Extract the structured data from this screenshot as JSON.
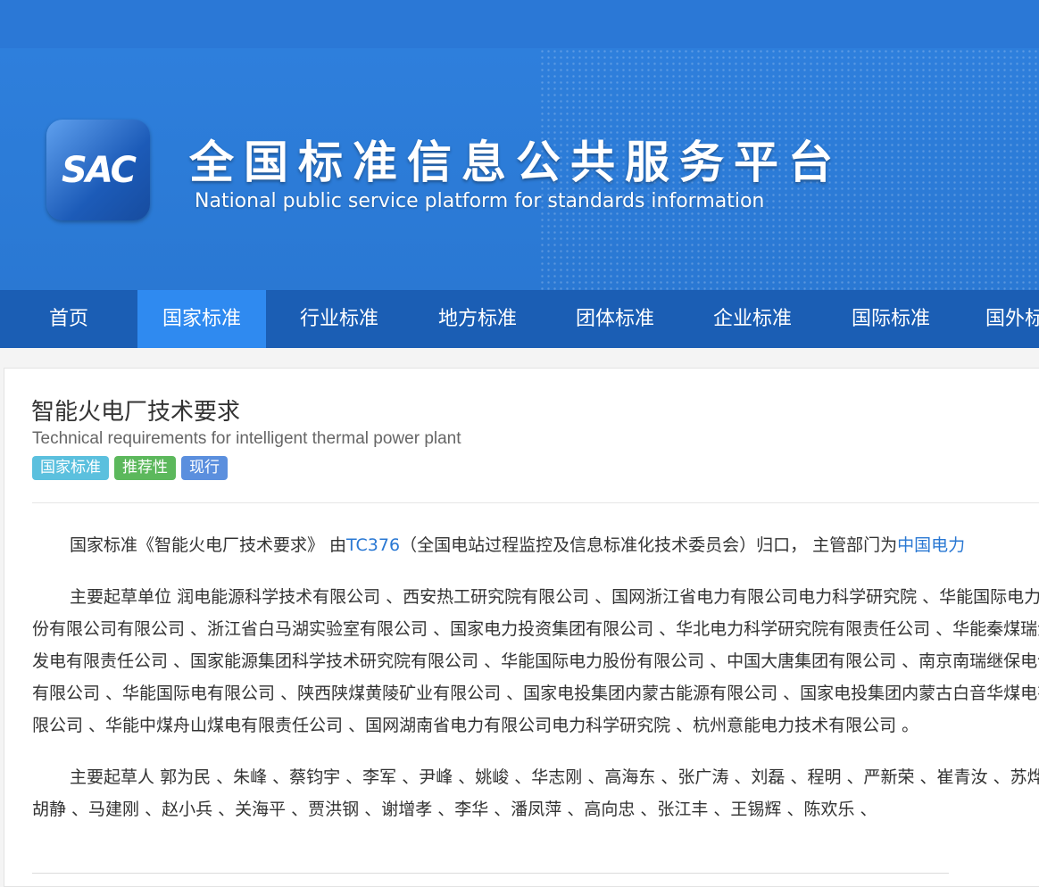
{
  "header": {
    "logo_text": "SAC",
    "title": "全国标准信息公共服务平台",
    "subtitle": "National public service platform  for standards information"
  },
  "nav": {
    "items": [
      "首页",
      "国家标准",
      "行业标准",
      "地方标准",
      "团体标准",
      "企业标准",
      "国际标准",
      "国外标"
    ],
    "active_index": 1
  },
  "standard": {
    "title_cn": "智能火电厂技术要求",
    "title_en": "Technical requirements for intelligent thermal power plant",
    "badges": [
      {
        "label": "国家标准",
        "color": "#5bc0de"
      },
      {
        "label": "推荐性",
        "color": "#5cb85c"
      },
      {
        "label": "现行",
        "color": "#5b8fde"
      }
    ],
    "intro_prefix": "国家标准《智能火电厂技术要求》 由",
    "intro_tc_link": "TC376",
    "intro_middle": "（全国电站过程监控及信息标准化技术委员会）归口， 主管部门为",
    "intro_dept_link": "中国电力",
    "drafting_units_label": "主要起草单位",
    "drafting_units_text": "润电能源科学技术有限公司 、西安热工研究院有限公司 、国网浙江省电力有限公司电力科学研究院 、华能国际电力股份有限公司有限公司 、浙江省白马湖实验室有限公司 、国家电力投资集团有限公司 、华北电力科学研究院有限责任公司 、华能秦煤瑞金发电有限责任公司 、国家能源集团科学技术研究院有限公司 、华能国际电力股份有限公司 、中国大唐集团有限公司 、南京南瑞继保电气有限公司 、华能国际电有限公司 、陕西陕煤黄陵矿业有限公司 、国家电投集团内蒙古能源有限公司 、国家电投集团内蒙古白音华煤电有限公司 、华能中煤舟山煤电有限责任公司 、国网湖南省电力有限公司电力科学研究院 、杭州意能电力技术有限公司 。",
    "drafters_label": "主要起草人",
    "drafters_text": "郭为民 、朱峰 、蔡钧宇 、李军 、尹峰 、姚峻 、华志刚 、高海东 、张广涛 、刘磊 、程明 、严新荣 、崔青汝 、苏烨 、胡静 、马建刚 、赵小兵 、关海平 、贾洪钢 、谢增孝 、李华 、潘凤萍 、高向忠 、张江丰 、王锡辉 、陈欢乐 、"
  },
  "colors": {
    "banner": "#2b78d6",
    "nav": "#1b5eb4",
    "nav_active": "#2f8af0",
    "link": "#2a78d3"
  }
}
